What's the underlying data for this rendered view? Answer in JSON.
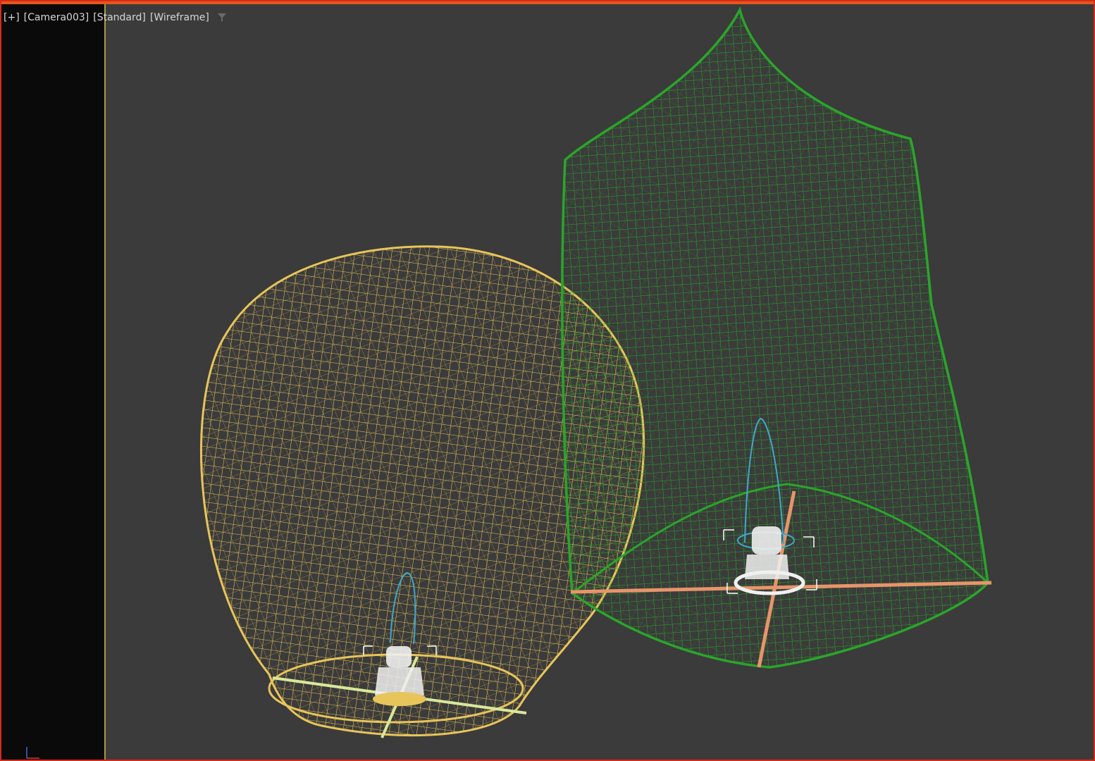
{
  "viewport": {
    "labels": {
      "plus_menu": "[+]",
      "camera": "[Camera003]",
      "shading_preset": "[Standard]",
      "display_mode": "[Wireframe]"
    },
    "filter_icon": "filter-icon"
  },
  "colors": {
    "viewport_bg": "#3b3b3b",
    "active_border": "#d42a1a",
    "safe_frame": "#0a0a0a",
    "lantern_yellow": "#e8c55a",
    "lantern_green": "#27a027",
    "light_gizmo_blue": "#3fa9c9",
    "cross_bar_orange": "#e8946a",
    "cross_bar_light": "#d7e89a",
    "burner_white": "#f0f0f0"
  },
  "scene": {
    "objects": [
      "yellow-lantern-wireframe",
      "green-lantern-wireframe"
    ]
  }
}
